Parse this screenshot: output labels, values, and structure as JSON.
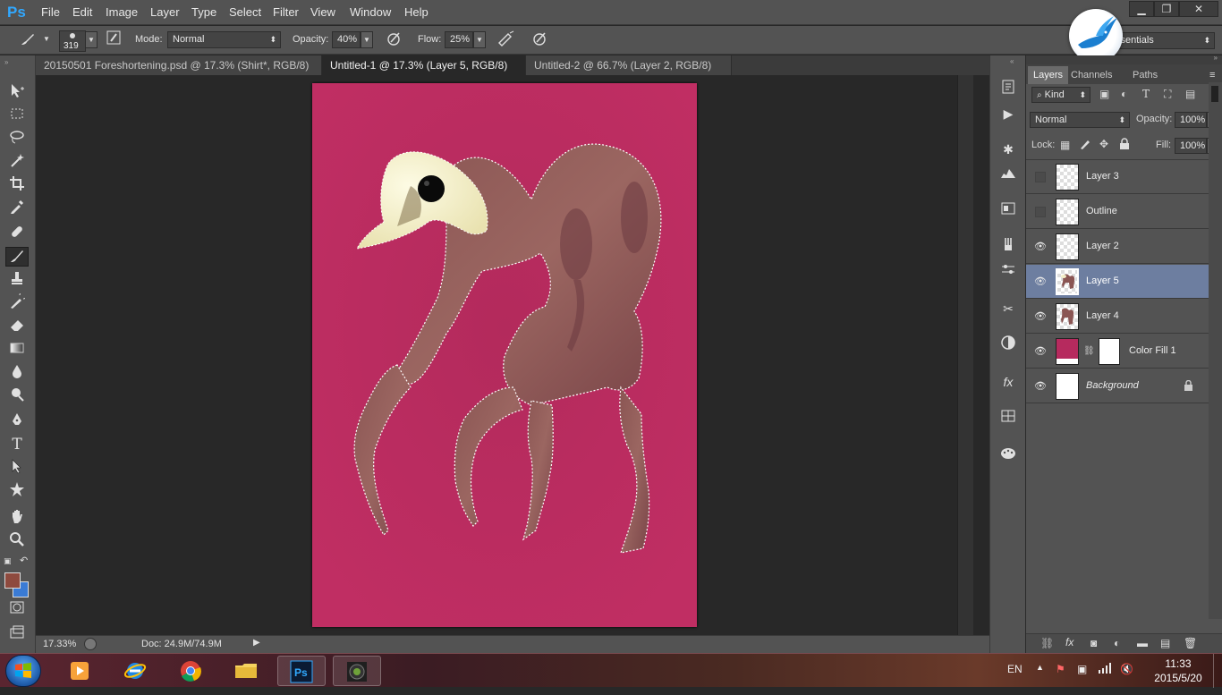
{
  "app": {
    "logo": "Ps"
  },
  "menu": [
    "File",
    "Edit",
    "Image",
    "Layer",
    "Type",
    "Select",
    "Filter",
    "View",
    "Window",
    "Help"
  ],
  "workspace_switcher": {
    "value": "Essentials",
    "visible_text": "ssentials"
  },
  "window_controls": {
    "minimize": "▁",
    "restore": "❐",
    "close": "✕"
  },
  "options": {
    "brush_size": "319",
    "mode_label": "Mode:",
    "mode_value": "Normal",
    "opacity_label": "Opacity:",
    "opacity_value": "40%",
    "flow_label": "Flow:",
    "flow_value": "25%"
  },
  "tabs": [
    {
      "label": "20150501 Foreshortening.psd @ 17.3% (Shirt*, RGB/8) *",
      "active": false
    },
    {
      "label": "Untitled-1 @ 17.3% (Layer 5, RGB/8) *",
      "active": true
    },
    {
      "label": "Untitled-2 @ 66.7% (Layer 2, RGB/8) *",
      "active": false
    }
  ],
  "tab_close": "×",
  "status": {
    "zoom": "17.33%",
    "doc": "Doc: 24.9M/74.9M"
  },
  "colors": {
    "foreground": "#8e4a3e",
    "background": "#3a7bd5",
    "canvas": "#b62a5e",
    "accent": "#31a8ff"
  },
  "layers_panel": {
    "tabs": [
      "Layers",
      "Channels",
      "Paths"
    ],
    "filter_label": "Kind",
    "blend_mode": "Normal",
    "opacity_label": "Opacity:",
    "opacity_value": "100%",
    "lock_label": "Lock:",
    "fill_label": "Fill:",
    "fill_value": "100%",
    "layers": [
      {
        "name": "Layer 3",
        "visible": false
      },
      {
        "name": "Outline",
        "visible": false
      },
      {
        "name": "Layer 2",
        "visible": true
      },
      {
        "name": "Layer 5",
        "visible": true,
        "selected": true
      },
      {
        "name": "Layer 4",
        "visible": true
      },
      {
        "name": "Color Fill 1",
        "visible": true
      },
      {
        "name": "Background",
        "visible": true,
        "locked": true
      }
    ]
  },
  "taskbar": {
    "lang": "EN",
    "time": "11:33",
    "date": "2015/5/20"
  }
}
